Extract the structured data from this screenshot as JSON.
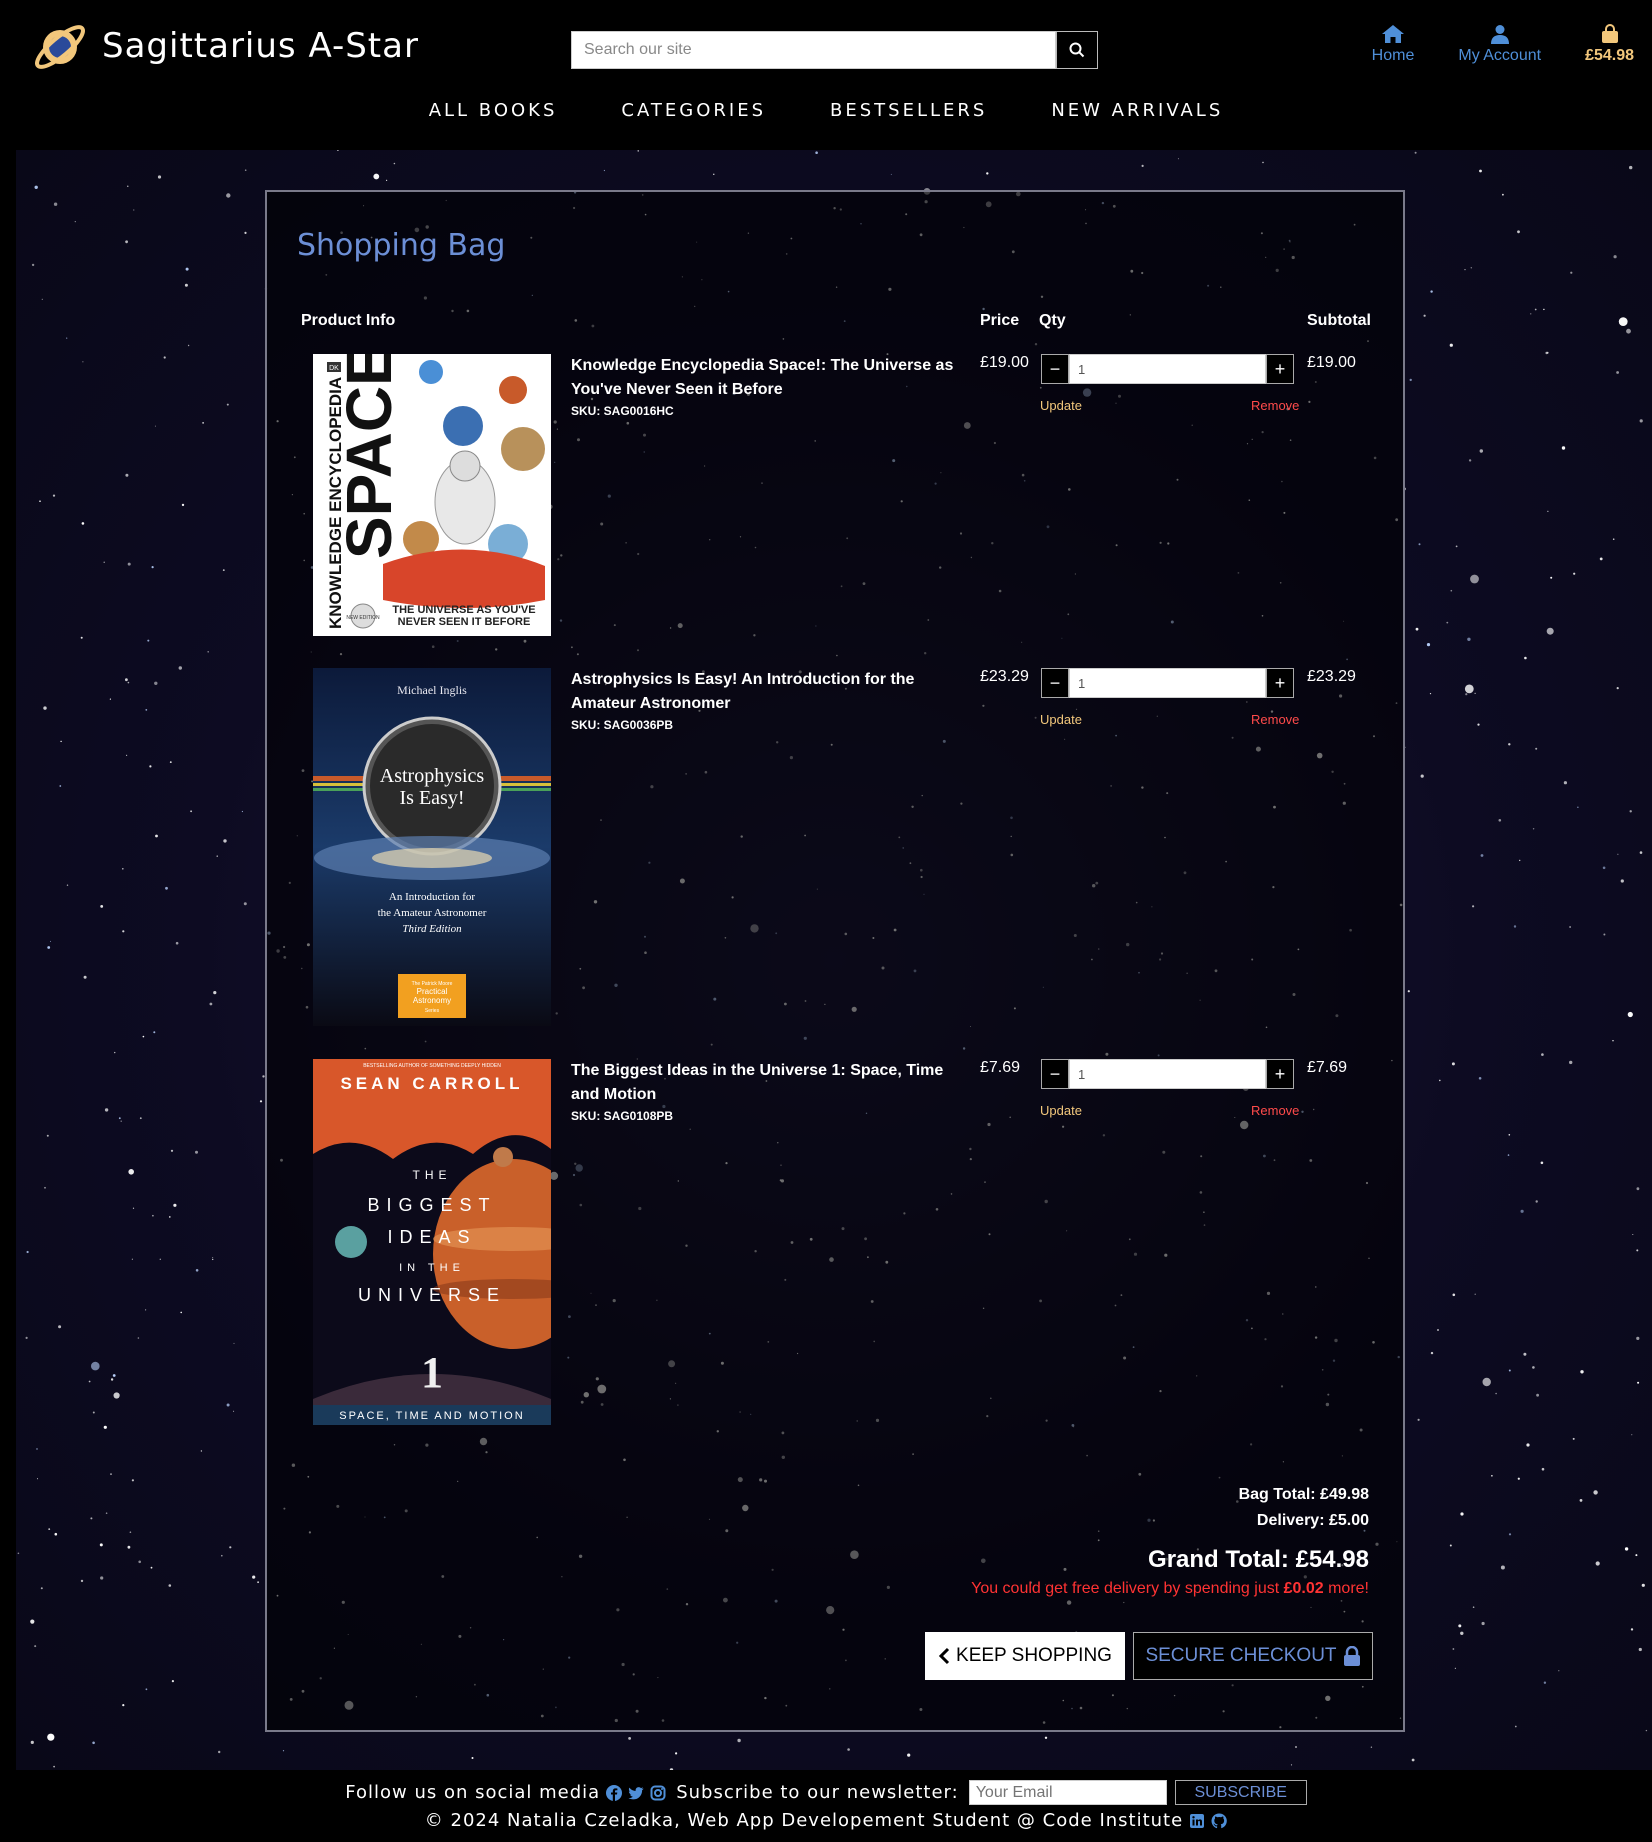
{
  "brand": {
    "name": "Sagittarius A-Star"
  },
  "search": {
    "placeholder": "Search our site"
  },
  "header_nav": {
    "home": "Home",
    "account": "My Account",
    "bag_total": "£54.98"
  },
  "main_nav": [
    "ALL BOOKS",
    "CATEGORIES",
    "BESTSELLERS",
    "NEW ARRIVALS"
  ],
  "bag": {
    "title": "Shopping Bag",
    "columns": {
      "product": "Product Info",
      "price": "Price",
      "qty": "Qty",
      "subtotal": "Subtotal"
    },
    "update_label": "Update",
    "remove_label": "Remove",
    "items": [
      {
        "name": "Knowledge Encyclopedia Space!: The Universe as You've Never Seen it Before",
        "sku": "SKU: SAG0016HC",
        "price": "£19.00",
        "qty": "1",
        "subtotal": "£19.00",
        "cover": {
          "publisher": "DK",
          "series": "KNOWLEDGE ENCYCLOPEDIA",
          "title": "SPACE!",
          "badge": "NEW EDITION",
          "tagline": "THE UNIVERSE AS YOU'VE NEVER SEEN IT BEFORE"
        }
      },
      {
        "name": "Astrophysics Is Easy! An Introduction for the Amateur Astronomer",
        "sku": "SKU: SAG0036PB",
        "price": "£23.29",
        "qty": "1",
        "subtotal": "£23.29",
        "cover": {
          "author": "Michael Inglis",
          "title_1": "Astrophysics",
          "title_2": "Is Easy!",
          "subtitle_1": "An Introduction for",
          "subtitle_2": "the Amateur Astronomer",
          "edition": "Third Edition",
          "series_1": "The Patrick Moore",
          "series_2": "Practical",
          "series_3": "Astronomy",
          "series_4": "Series"
        }
      },
      {
        "name": "The Biggest Ideas in the Universe 1: Space, Time and Motion",
        "sku": "SKU: SAG0108PB",
        "price": "£7.69",
        "qty": "1",
        "subtotal": "£7.69",
        "cover": {
          "kicker": "BESTSELLING AUTHOR OF SOMETHING DEEPLY HIDDEN",
          "author": "SEAN CARROLL",
          "line1": "THE",
          "line2": "BIGGEST",
          "line3": "IDEAS",
          "line4": "IN THE",
          "line5": "UNIVERSE",
          "number": "1",
          "subtitle": "SPACE, TIME AND MOTION"
        }
      }
    ],
    "bag_total": "Bag Total: £49.98",
    "delivery": "Delivery: £5.00",
    "grand_total": "Grand Total: £54.98",
    "free_delivery_pre": "You could get free delivery by spending just ",
    "free_delivery_amount": "£0.02",
    "free_delivery_post": " more!",
    "keep_shopping": "KEEP SHOPPING",
    "secure_checkout": "SECURE CHECKOUT"
  },
  "footer": {
    "follow": "Follow us on social media",
    "subscribe_text": "Subscribe to our newsletter:",
    "email_placeholder": "Your Email",
    "subscribe_button": "SUBSCRIBE",
    "copyright": "© 2024 Natalia Czeladka, Web App Developement Student @ Code Institute"
  },
  "colors": {
    "accent_blue": "#6c8fd6",
    "link_blue": "#4f8fd8",
    "gold": "#f2c77c",
    "alert_red": "#ff3333"
  },
  "icons": [
    "planet-logo-icon",
    "search-icon",
    "home-icon",
    "user-icon",
    "shopping-bag-icon",
    "chevron-left-icon",
    "lock-icon",
    "facebook-icon",
    "twitter-icon",
    "instagram-icon",
    "linkedin-icon",
    "github-icon"
  ]
}
